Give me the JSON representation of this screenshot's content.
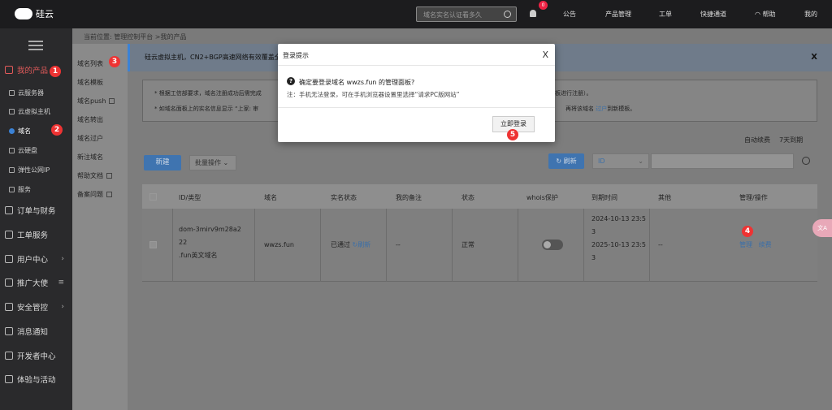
{
  "brand": {
    "name": "硅云"
  },
  "topbar": {
    "search_placeholder": "域名实名认证看多久",
    "notif_count": "0",
    "nav": [
      "公告",
      "产品管理",
      "工单",
      "快捷通道",
      "帮助",
      "我的"
    ]
  },
  "sidebar": {
    "items": [
      {
        "label": "我的产品",
        "active": true
      },
      {
        "label": "订单与财务"
      },
      {
        "label": "工单服务"
      },
      {
        "label": "用户中心"
      },
      {
        "label": "推广大使"
      },
      {
        "label": "安全管控"
      },
      {
        "label": "消息通知"
      },
      {
        "label": "开发者中心"
      },
      {
        "label": "体验与活动"
      }
    ],
    "subitems": [
      "云服务器",
      "云虚拟主机",
      "域名",
      "云硬盘",
      "弹性公网IP",
      "服务"
    ]
  },
  "breadcrumb": "当前位置: 管理控制平台 >我的产品",
  "subnav": [
    "域名列表",
    "域名模板",
    "域名push",
    "域名转出",
    "域名过户",
    "新注域名",
    "帮助文档",
    "备案问题"
  ],
  "banner": {
    "text": "硅云虚拟主机，CN2+BGP高速网络有效覆盖全",
    "close": "X"
  },
  "notice": {
    "line1": "* 根据工信部要求，域名注册成功后需完成",
    "line1_tail": "模板进行注册）。",
    "line2": "* 如域名面板上的实名信息显示 “上家: 审",
    "line2_tail": "再将该域名",
    "line2_link": "过户",
    "line2_end": "到新模板。"
  },
  "filters": {
    "auto_renew": "自动续费",
    "expiring": "7天到期"
  },
  "toolbar": {
    "new": "新建",
    "batch": "批量操作",
    "refresh": "刷新",
    "id_select": "ID"
  },
  "table": {
    "headers": [
      "ID/类型",
      "域名",
      "实名状态",
      "我的备注",
      "状态",
      "whois保护",
      "到期时间",
      "其他",
      "管理/操作"
    ],
    "row": {
      "id_line1": "dom-3mirv9m28a2",
      "id_line2": "22",
      "id_line3": ".fun英文域名",
      "domain": "wwzs.fun",
      "realname": "已通过",
      "realname_refresh": "刷新",
      "remark": "--",
      "status": "正常",
      "date1_a": "2024-10-13 23:5",
      "date1_b": "3",
      "date2_a": "2025-10-13 23:5",
      "date2_b": "3",
      "other": "--",
      "manage": "管理",
      "renew": "续费"
    }
  },
  "modal": {
    "title": "登录提示",
    "close": "X",
    "message": "确定要登录域名  wwzs.fun  的管理面板?",
    "note": "注：手机无法登录，可在手机浏览器设置里选择“请求PC版网站”",
    "button": "立即登录"
  },
  "markers": [
    "1",
    "2",
    "3",
    "4",
    "5"
  ],
  "translate_label": "文A"
}
